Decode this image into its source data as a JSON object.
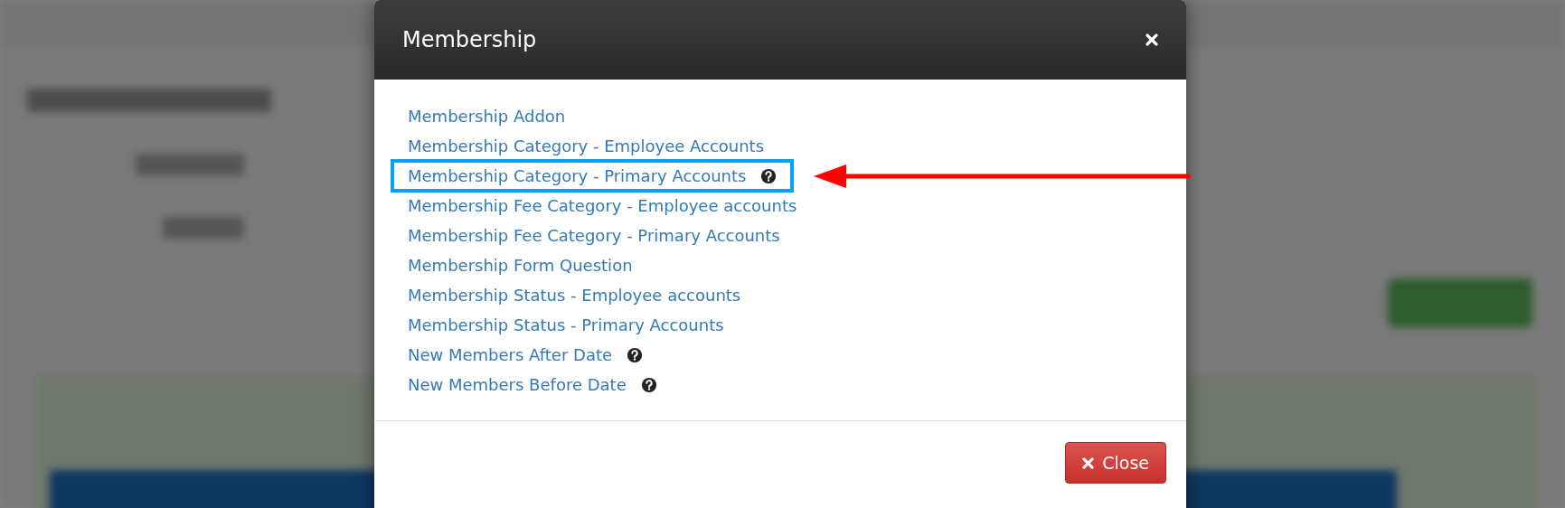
{
  "dialog": {
    "title": "Membership",
    "items": [
      {
        "label": "Membership Addon",
        "help": false,
        "highlighted": false
      },
      {
        "label": "Membership Category - Employee Accounts",
        "help": false,
        "highlighted": false
      },
      {
        "label": "Membership Category - Primary Accounts",
        "help": true,
        "highlighted": true
      },
      {
        "label": "Membership Fee Category - Employee accounts",
        "help": false,
        "highlighted": false
      },
      {
        "label": "Membership Fee Category - Primary Accounts",
        "help": false,
        "highlighted": false
      },
      {
        "label": "Membership Form Question",
        "help": false,
        "highlighted": false
      },
      {
        "label": "Membership Status - Employee accounts",
        "help": false,
        "highlighted": false
      },
      {
        "label": "Membership Status - Primary Accounts",
        "help": false,
        "highlighted": false
      },
      {
        "label": "New Members After Date",
        "help": true,
        "highlighted": false
      },
      {
        "label": "New Members Before Date",
        "help": true,
        "highlighted": false
      }
    ],
    "close_button": "Close"
  }
}
